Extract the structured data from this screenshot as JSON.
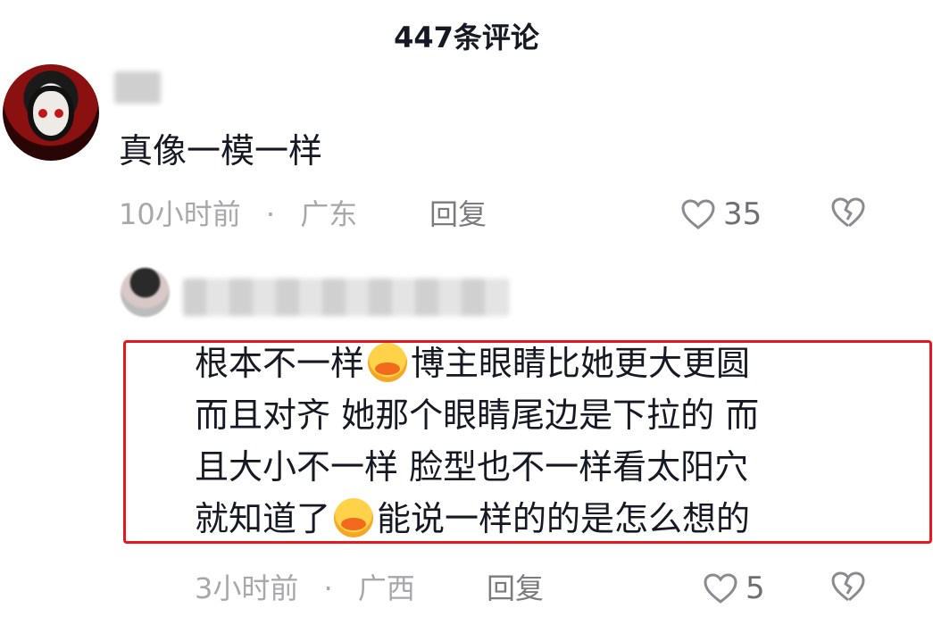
{
  "header": {
    "title": "447条评论"
  },
  "comment": {
    "text": "真像一模一样",
    "time": "10小时前",
    "dot": "·",
    "location": "广东",
    "reply_label": "回复",
    "likes": "35"
  },
  "reply": {
    "lines": [
      {
        "a": "根本不一样",
        "b": "博主眼睛比她更大更圆"
      },
      {
        "text": "而且对齐 她那个眼睛尾边是下拉的 而"
      },
      {
        "text": "且大小不一样 脸型也不一样看太阳穴"
      },
      {
        "a": "就知道了",
        "b": "能说一样的的是怎么想的"
      }
    ],
    "time": "3小时前",
    "dot": "·",
    "location": "广西",
    "reply_label": "回复",
    "likes": "5"
  },
  "colors": {
    "highlight_border": "#e8171f",
    "meta_text": "#a7a8ac",
    "main_text": "#161823"
  },
  "icons": {
    "like": "heart-outline-icon",
    "dislike": "broken-heart-icon",
    "emoji": "face-emoji-icon"
  }
}
